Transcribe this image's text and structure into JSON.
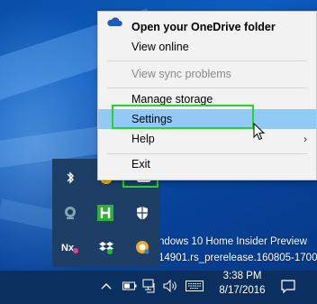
{
  "menu": {
    "items": [
      {
        "label": "Open your OneDrive folder",
        "style": "bold"
      },
      {
        "label": "View online"
      },
      {
        "label": "View sync problems",
        "state": "disabled"
      },
      {
        "label": "Manage storage"
      },
      {
        "label": "Settings",
        "state": "hover"
      },
      {
        "label": "Help",
        "submenu": "›"
      },
      {
        "label": "Exit"
      }
    ]
  },
  "desktop": {
    "watermark_line1": "ndows 10 Home Insider Preview",
    "watermark_line2": "14901.rs_prerelease.160805-1700"
  },
  "tray_flyout": {
    "icons": [
      "bluetooth-icon",
      "norton-icon",
      "onedrive-icon",
      "webcam-icon",
      "h-app-icon",
      "defender-icon",
      "nx-icon",
      "dropbox-icon",
      "update-icon"
    ]
  },
  "taskbar": {
    "time": "3:38 PM",
    "date": "8/17/2016",
    "icons": [
      "show-hidden-icons-chevron",
      "battery-icon",
      "network-icon",
      "volume-icon",
      "keyboard-icon",
      "action-center-icon"
    ]
  },
  "colors": {
    "menu_bg": "#f2f2f2",
    "menu_hover": "#91c9f7",
    "highlight_box": "#29d429",
    "taskbar_bg": "#0b3060",
    "flyout_bg": "#1d3f66"
  }
}
